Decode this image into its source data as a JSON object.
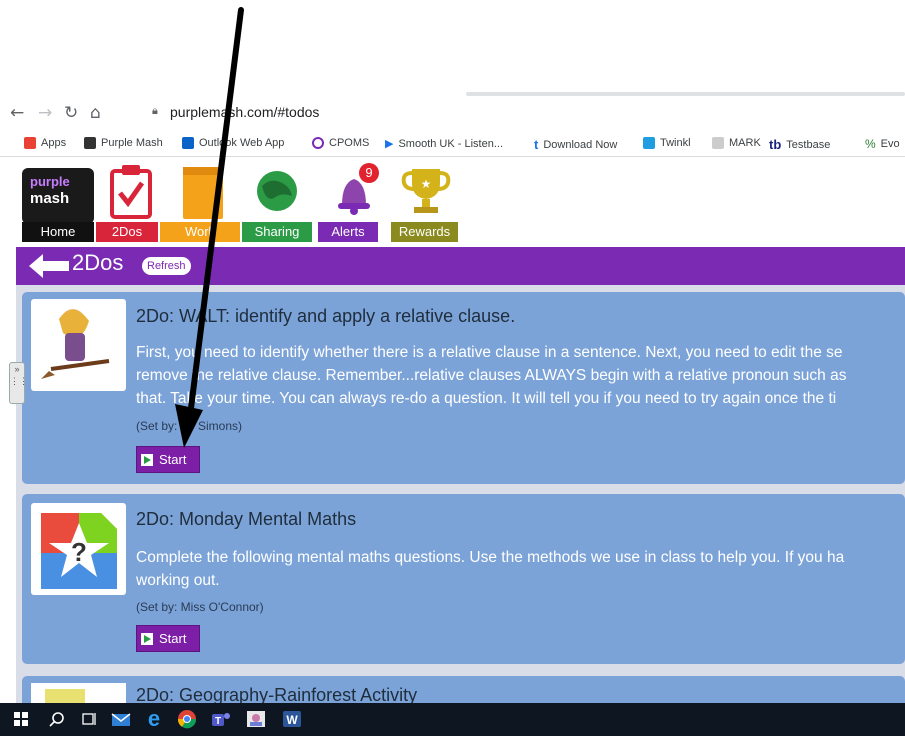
{
  "browser": {
    "url": "purplemash.com/#todos",
    "bookmarks": [
      {
        "label": "Apps",
        "icon": "apps-grid-icon",
        "color": "#e94235"
      },
      {
        "label": "Purple Mash",
        "icon": "purple-mash-icon",
        "color": "#333333"
      },
      {
        "label": "Outlook Web App",
        "icon": "outlook-icon",
        "color": "#0a64c8"
      },
      {
        "label": "CPOMS",
        "icon": "cpoms-icon",
        "color": "#7b2ab4"
      },
      {
        "label": "Smooth UK - Listen...",
        "icon": "smooth-icon",
        "color": "#1a73e8"
      },
      {
        "label": "Download Now",
        "icon": "download-icon",
        "color": "#1a73e8"
      },
      {
        "label": "Twinkl",
        "icon": "twinkl-icon",
        "color": "#1f9de0"
      },
      {
        "label": "MARK",
        "icon": "mark-icon",
        "color": "#999999"
      },
      {
        "label": "Testbase",
        "icon": "testbase-icon",
        "color": "#1a237e"
      },
      {
        "label": "Evo",
        "icon": "evo-icon",
        "color": "#2e7d32"
      }
    ]
  },
  "logo": {
    "line1": "purple",
    "line2": "mash"
  },
  "nav": [
    {
      "label": "Home",
      "color": "#111111"
    },
    {
      "label": "2Dos",
      "color": "#d9253a"
    },
    {
      "label": "Work",
      "color": "#f4a21a"
    },
    {
      "label": "Sharing",
      "color": "#2b9b46"
    },
    {
      "label": "Alerts",
      "color": "#7b2ab4"
    },
    {
      "label": "Rewards",
      "color": "#8a8a1e"
    }
  ],
  "alerts_badge": "9",
  "page": {
    "title": "2Dos",
    "refresh_label": "Refresh"
  },
  "todos": [
    {
      "title": "2Do: WALT: identify and apply a relative clause.",
      "description_lines": [
        "First, you need to identify whether there is a relative clause in a sentence. Next, you need to edit the se",
        "remove the relative clause. Remember...relative clauses ALWAYS begin with a relative pronoun such as",
        "that. Take your time. You can always re-do a question. It will tell you if you need to try again once the ti"
      ],
      "set_by": "(Set by: Mr Simons)",
      "start_label": "Start"
    },
    {
      "title": "2Do: Monday Mental Maths",
      "description_lines": [
        "Complete the following mental maths questions. Use the methods we use in class to help you. If you ha",
        "working out."
      ],
      "set_by": "(Set by: Miss O'Connor)",
      "start_label": "Start"
    },
    {
      "title": "2Do: Geography-Rainforest Activity"
    }
  ],
  "colors": {
    "brand_purple": "#7b2ab4",
    "card_blue": "#7ba3d7",
    "start_purple": "#7d1ea6"
  }
}
